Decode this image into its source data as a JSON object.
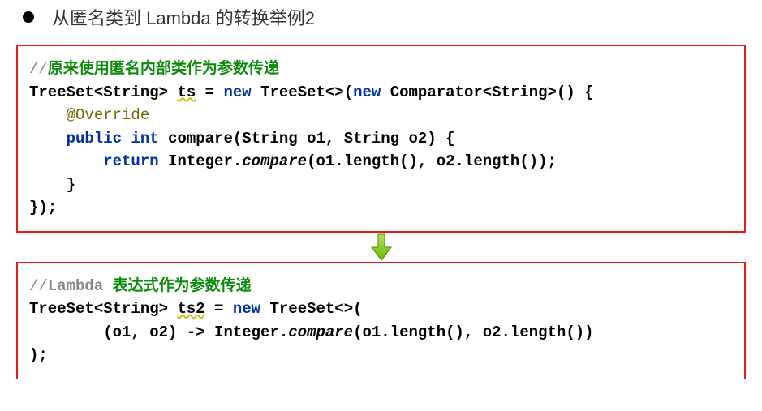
{
  "title": "从匿名类到 Lambda 的转换举例2",
  "box1": {
    "comment_prefix": "//",
    "comment_text": "原来使用匿名内部类作为参数传递",
    "l2_a": "TreeSet<String> ",
    "l2_var": "ts",
    "l2_b": " = ",
    "l2_new1": "new",
    "l2_c": " TreeSet<>(",
    "l2_new2": "new",
    "l2_d": " Comparator<String>() {",
    "l3_at": "@Override",
    "l4_pub": "public",
    "l4_int": " int",
    "l4_sp": " ",
    "l4_name": "compare",
    "l4_args": "(String o1, String o2) {",
    "l5_ret": "return",
    "l5_sp": " ",
    "l5_cls": "Integer.",
    "l5_meth": "compare",
    "l5_args": "(o1.length(), o2.length());",
    "l6": "}",
    "l7": "});"
  },
  "box2": {
    "comment_prefix": "//",
    "comment_label": "Lambda",
    "comment_text": " 表达式作为参数传递",
    "l2_a": "TreeSet<String> ",
    "l2_var": "ts2",
    "l2_b": " = ",
    "l2_new": "new",
    "l2_c": " TreeSet<>(",
    "l3_a": "(o1, o2) -> Integer.",
    "l3_meth": "compare",
    "l3_b": "(o1.length(), o2.length())",
    "l4": ");"
  }
}
